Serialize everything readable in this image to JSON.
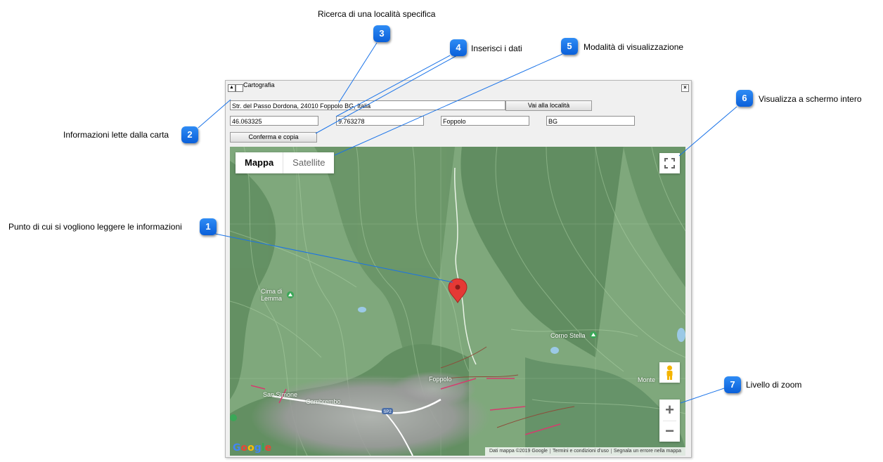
{
  "window": {
    "title": "Cartografia",
    "close_icon": "×",
    "address_value": "Str. del Passo Dordona, 24010 Foppolo BG, Italia",
    "go_button": "Vai alla località",
    "lat_value": "46.063325",
    "lon_value": "9.763278",
    "city_value": "Foppolo",
    "province_value": "BG",
    "confirm_button": "Conferma e copia"
  },
  "map": {
    "type_map": "Mappa",
    "type_satellite": "Satellite",
    "zoom_in": "+",
    "zoom_out": "−",
    "places": {
      "cima_di": "Cima di",
      "lemma": "Lemma",
      "corno_stella": "Corno Stella",
      "foppolo": "Foppolo",
      "monte": "Monte",
      "san_simone": "San Simone",
      "cambrembo": "Cambrembo",
      "sp2": "SP2"
    },
    "google_logo": "Google",
    "footer": {
      "data": "Dati mappa ©2019 Google",
      "terms": "Termini e condizioni d'uso",
      "report": "Segnala un errore nella mappa"
    }
  },
  "callouts": [
    {
      "number": "1",
      "label": "Punto di cui si vogliono leggere le informazioni"
    },
    {
      "number": "2",
      "label": "Informazioni lette dalla carta"
    },
    {
      "number": "3",
      "label": "Ricerca di una località specifica"
    },
    {
      "number": "4",
      "label": "Inserisci i dati"
    },
    {
      "number": "5",
      "label": "Modalità di visualizzazione"
    },
    {
      "number": "6",
      "label": "Visualizza a schermo intero"
    },
    {
      "number": "7",
      "label": "Livello di zoom"
    }
  ],
  "colors": {
    "badge": "#1a73e8",
    "map_green": "#7ea77b",
    "marker": "#e53935"
  }
}
